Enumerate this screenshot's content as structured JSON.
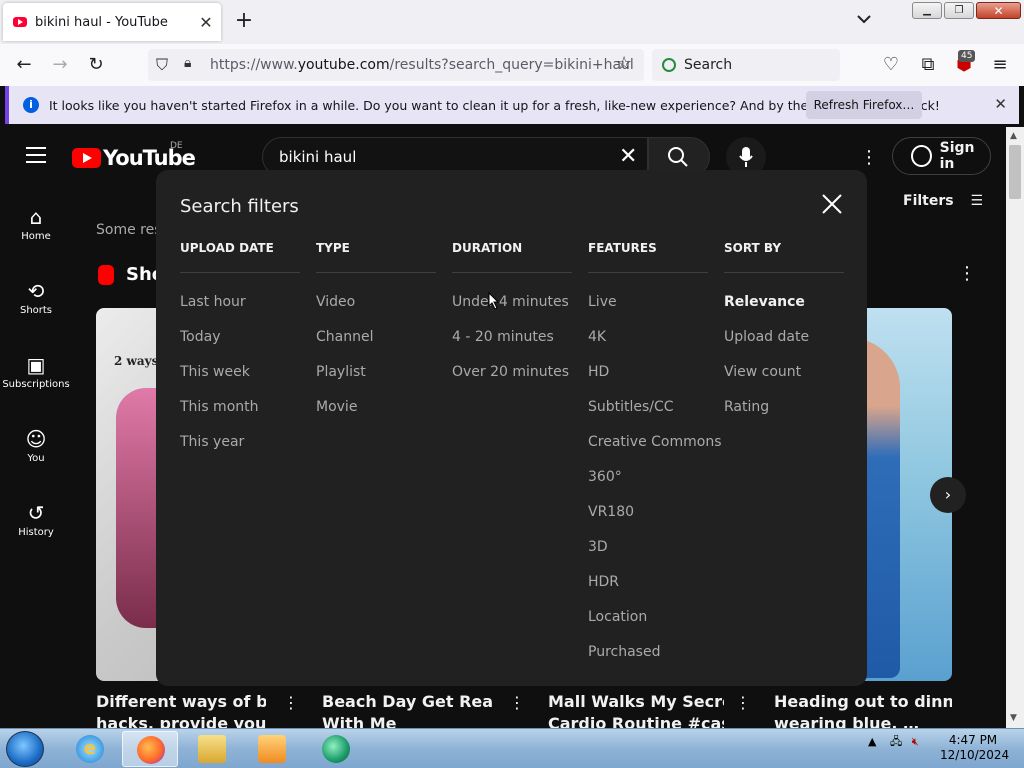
{
  "browser": {
    "tab_title": "bikini haul - YouTube",
    "url_prefix": "https://www.",
    "url_domain": "youtube.com",
    "url_rest": "/results?search_query=bikini+haul",
    "search_placeholder": "Search",
    "extension_badge": "45"
  },
  "notification": {
    "text": "It looks like you haven't started Firefox in a while. Do you want to clean it up for a fresh, like-new experience? And by the way, welcome back!",
    "button_label": "Refresh Firefox…"
  },
  "youtube": {
    "logo_text": "YouTube",
    "region": "DE",
    "search_query": "bikini haul",
    "sign_in_label": "Sign in",
    "filters_label": "Filters",
    "some_results_text": "Some res",
    "shorts_label": "Sho",
    "sidebar": [
      {
        "label": "Home",
        "icon": "home-icon"
      },
      {
        "label": "Shorts",
        "icon": "shorts-icon"
      },
      {
        "label": "Subscriptions",
        "icon": "subscriptions-icon"
      },
      {
        "label": "You",
        "icon": "you-icon"
      },
      {
        "label": "History",
        "icon": "history-icon"
      }
    ],
    "thumb1_caption": "2 ways",
    "videos": [
      {
        "line1": "Different ways of bikini",
        "line2": "hacks, provide you the…"
      },
      {
        "line1": "Beach Day Get Ready",
        "line2": "With Me"
      },
      {
        "line1": "Mall Walks My Secret",
        "line2": "Cardio Routine #casua…"
      },
      {
        "line1": "Heading out to dinner,",
        "line2": "wearing blue. …"
      }
    ]
  },
  "filters_modal": {
    "title": "Search filters",
    "columns": [
      {
        "heading": "UPLOAD DATE",
        "items": [
          "Last hour",
          "Today",
          "This week",
          "This month",
          "This year"
        ]
      },
      {
        "heading": "TYPE",
        "items": [
          "Video",
          "Channel",
          "Playlist",
          "Movie"
        ]
      },
      {
        "heading": "DURATION",
        "items": [
          "Under 4 minutes",
          "4 - 20 minutes",
          "Over 20 minutes"
        ]
      },
      {
        "heading": "FEATURES",
        "items": [
          "Live",
          "4K",
          "HD",
          "Subtitles/CC",
          "Creative Commons",
          "360°",
          "VR180",
          "3D",
          "HDR",
          "Location",
          "Purchased"
        ]
      },
      {
        "heading": "SORT BY",
        "items": [
          "Relevance",
          "Upload date",
          "View count",
          "Rating"
        ],
        "selected": "Relevance"
      }
    ]
  },
  "taskbar": {
    "time": "4:47 PM",
    "date": "12/10/2024"
  },
  "colors": {
    "youtube_red": "#ff0000",
    "firefox_accent": "#7542e5",
    "modal_bg": "#212121"
  }
}
